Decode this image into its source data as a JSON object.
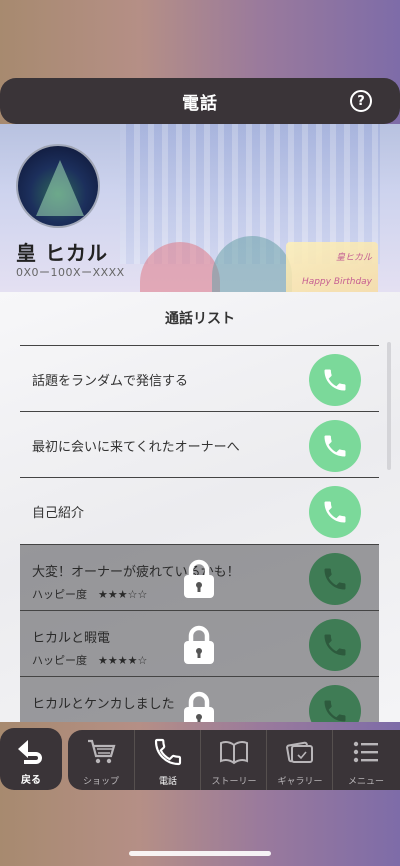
{
  "header": {
    "title": "電話",
    "help_label": "?"
  },
  "banner": {
    "card_top": "皇ヒカル",
    "card_text": "Happy Birthday"
  },
  "profile": {
    "name": "皇 ヒカル",
    "phone": "0X0ー100XーXXXX"
  },
  "call_list": {
    "title": "通話リスト",
    "items": [
      {
        "label": "話題をランダムで発信する",
        "locked": false
      },
      {
        "label": "最初に会いに来てくれたオーナーへ",
        "locked": false
      },
      {
        "label": "自己紹介",
        "locked": false
      },
      {
        "label": "大変！オーナーが疲れているかも！",
        "sub": "ハッピー度　★★★☆☆",
        "locked": true
      },
      {
        "label": "ヒカルと暇電",
        "sub": "ハッピー度　★★★★☆",
        "locked": true
      },
      {
        "label": "ヒカルとケンカしました",
        "sub": "",
        "locked": true
      }
    ]
  },
  "bottom_nav": {
    "back_label": "戻る",
    "items": [
      {
        "label": "ショップ",
        "icon": "cart-icon"
      },
      {
        "label": "電話",
        "icon": "phone-icon",
        "active": true
      },
      {
        "label": "ストーリー",
        "icon": "book-icon"
      },
      {
        "label": "ギャラリー",
        "icon": "photos-icon"
      },
      {
        "label": "メニュー",
        "icon": "menu-icon"
      }
    ]
  },
  "colors": {
    "accent_green": "#7bd99a",
    "dark_bar": "#3a3438"
  }
}
